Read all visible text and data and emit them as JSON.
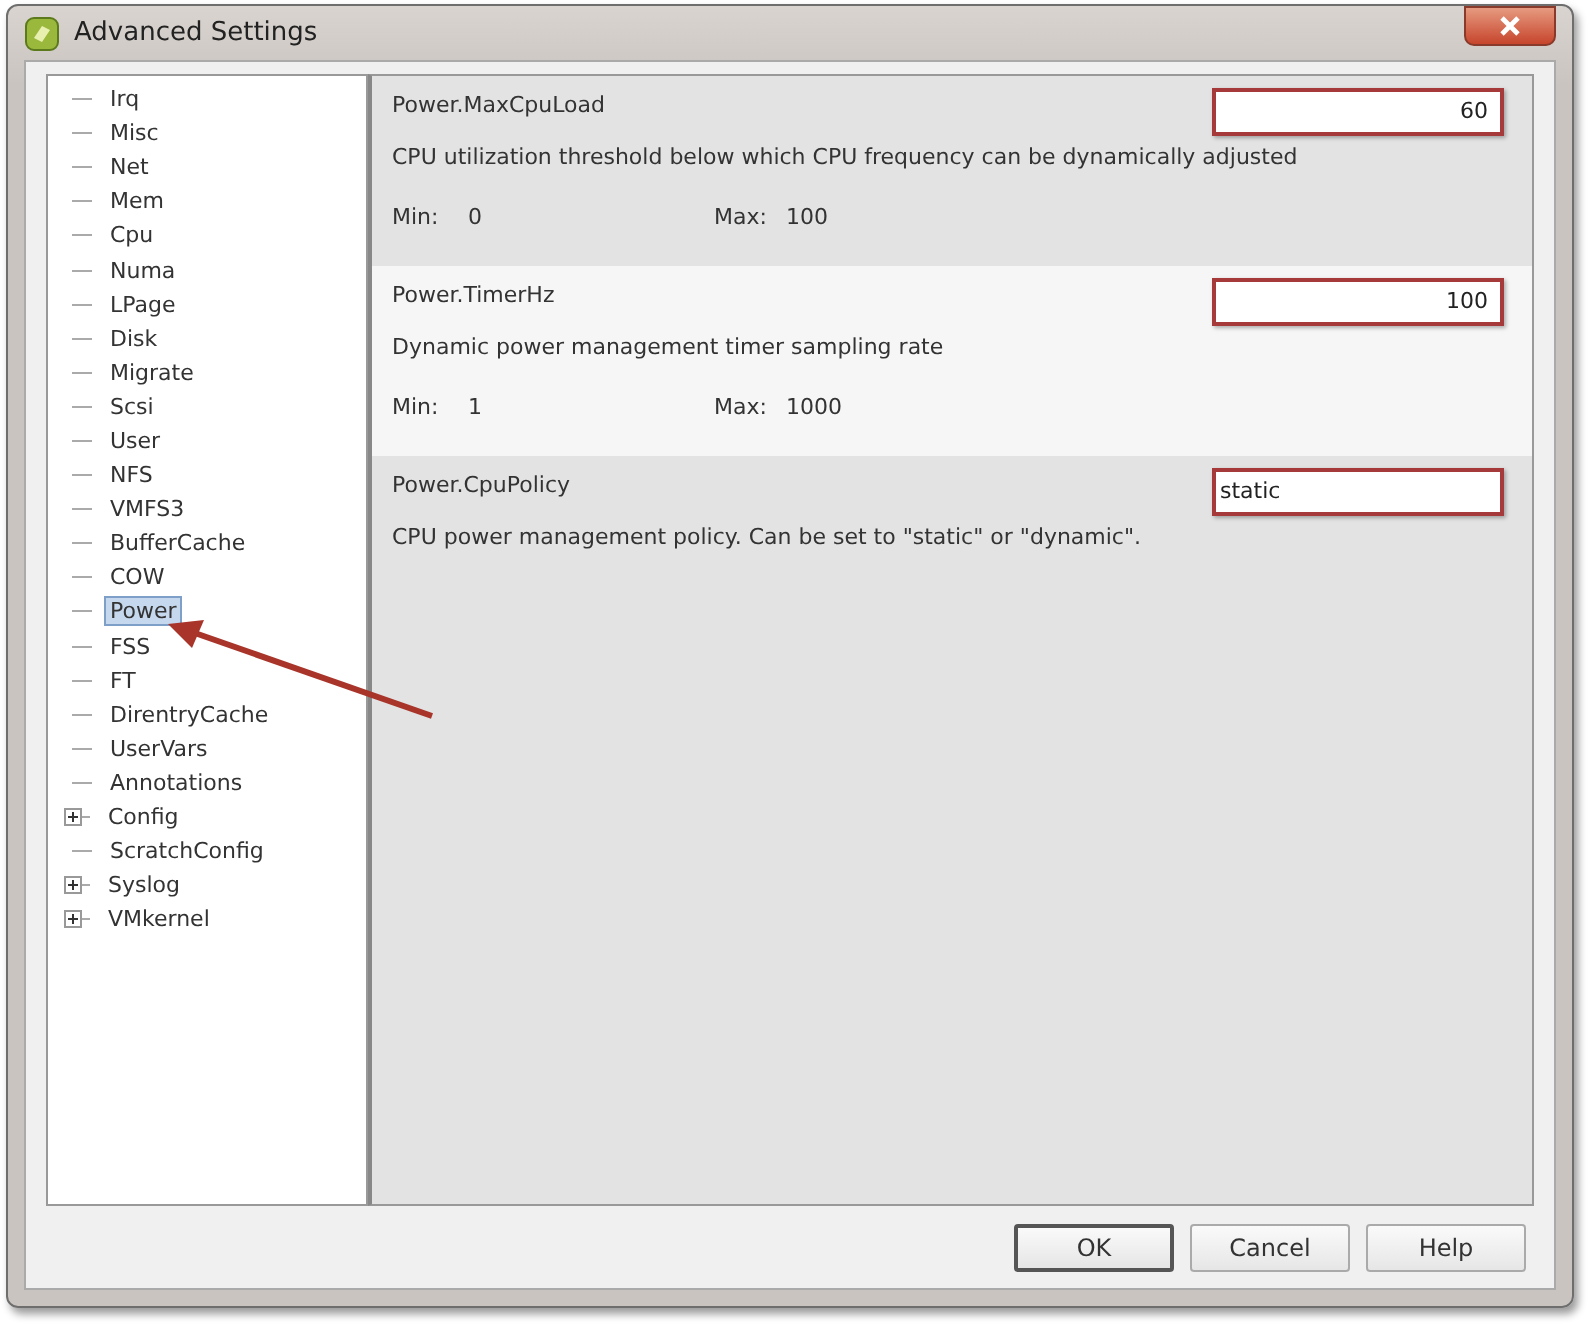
{
  "window": {
    "title": "Advanced Settings"
  },
  "tree": {
    "items": [
      {
        "label": "Irq",
        "selected": false
      },
      {
        "label": "Misc",
        "selected": false
      },
      {
        "label": "Net",
        "selected": false
      },
      {
        "label": "Mem",
        "selected": false
      },
      {
        "label": "Cpu",
        "selected": false
      },
      {
        "label": "Numa",
        "selected": false
      },
      {
        "label": "LPage",
        "selected": false
      },
      {
        "label": "Disk",
        "selected": false
      },
      {
        "label": "Migrate",
        "selected": false
      },
      {
        "label": "Scsi",
        "selected": false
      },
      {
        "label": "User",
        "selected": false
      },
      {
        "label": "NFS",
        "selected": false
      },
      {
        "label": "VMFS3",
        "selected": false
      },
      {
        "label": "BufferCache",
        "selected": false
      },
      {
        "label": "COW",
        "selected": false
      },
      {
        "label": "Power",
        "selected": true
      },
      {
        "label": "FSS",
        "selected": false
      },
      {
        "label": "FT",
        "selected": false
      },
      {
        "label": "DirentryCache",
        "selected": false
      },
      {
        "label": "UserVars",
        "selected": false
      },
      {
        "label": "Annotations",
        "selected": false
      },
      {
        "label": "Config",
        "selected": false,
        "expanded": false
      },
      {
        "label": "ScratchConfig",
        "selected": false
      },
      {
        "label": "Syslog",
        "selected": false,
        "expanded": false
      },
      {
        "label": "VMkernel",
        "selected": false,
        "expanded": false
      }
    ]
  },
  "settings": [
    {
      "name": "Power.MaxCpuLoad",
      "kind": "number",
      "value": "60",
      "description": "CPU utilization threshold below which CPU frequency can be dynamically adjusted",
      "min_label": "Min:",
      "min": "0",
      "max_label": "Max:",
      "max": "100"
    },
    {
      "name": "Power.TimerHz",
      "kind": "number",
      "value": "100",
      "description": "Dynamic power management timer sampling rate",
      "min_label": "Min:",
      "min": "1",
      "max_label": "Max:",
      "max": "1000"
    },
    {
      "name": "Power.CpuPolicy",
      "kind": "text",
      "value": "static",
      "description": "CPU power management policy.  Can be set to \"static\" or \"dynamic\"."
    }
  ],
  "buttons": [
    "OK",
    "Cancel",
    "Help"
  ]
}
